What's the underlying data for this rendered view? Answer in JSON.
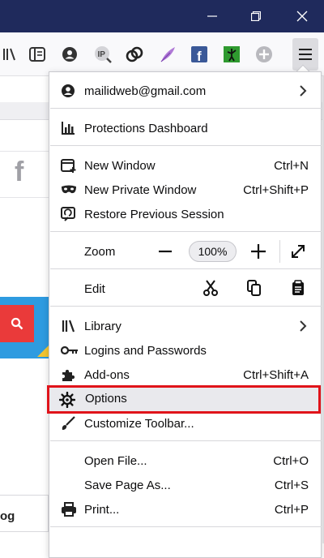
{
  "window": {
    "minimize_label": "Minimize",
    "restore_label": "Restore",
    "close_label": "Close"
  },
  "toolbar": {
    "icons": [
      "library-icon",
      "reader-view-icon",
      "account-icon",
      "ip-extension-icon",
      "copy-link-extension-icon",
      "feather-extension-icon",
      "facebook-extension-icon",
      "green-extension-icon",
      "add-extension-icon"
    ],
    "menu_button": "open-application-menu"
  },
  "page": {
    "facebook_letter": "f",
    "og_text": "og"
  },
  "menu": {
    "account_email": "mailidweb@gmail.com",
    "protections": "Protections Dashboard",
    "new_window": "New Window",
    "new_window_shortcut": "Ctrl+N",
    "new_private_window": "New Private Window",
    "new_private_window_shortcut": "Ctrl+Shift+P",
    "restore_session": "Restore Previous Session",
    "zoom_label": "Zoom",
    "zoom_minus": "−",
    "zoom_value": "100%",
    "zoom_plus": "+",
    "edit_label": "Edit",
    "library": "Library",
    "logins": "Logins and Passwords",
    "addons": "Add-ons",
    "addons_shortcut": "Ctrl+Shift+A",
    "options": "Options",
    "customize": "Customize Toolbar...",
    "open_file": "Open File...",
    "open_file_shortcut": "Ctrl+O",
    "save_page": "Save Page As...",
    "save_page_shortcut": "Ctrl+S",
    "print": "Print...",
    "print_shortcut": "Ctrl+P"
  },
  "colors": {
    "titlebar": "#1f2a5c",
    "highlight_border": "#e0131a",
    "accent_red": "#ea3a3a",
    "accent_blue": "#2e9be0"
  }
}
